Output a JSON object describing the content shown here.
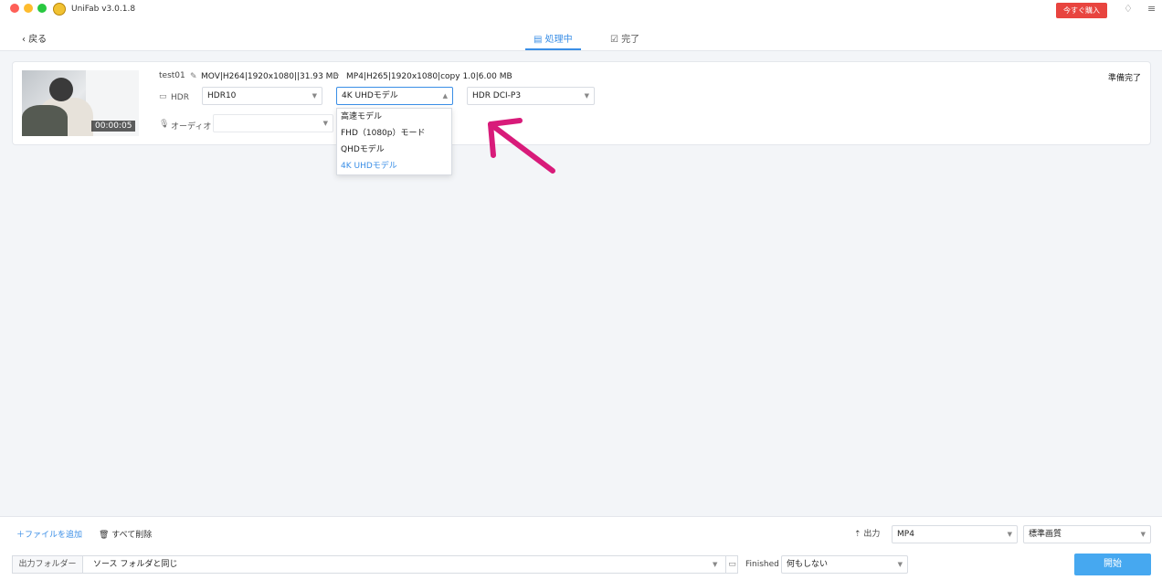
{
  "app": {
    "title": "UniFab v3.0.1.8",
    "buy_label": "今すぐ購入"
  },
  "nav": {
    "back_label": "戻る",
    "tabs": [
      {
        "label": "処理中",
        "active": true
      },
      {
        "label": "完了",
        "active": false
      }
    ]
  },
  "task": {
    "filename": "test01",
    "source_info": "MOV|H264|1920x1080||31.93 MB",
    "output_info": "MP4|H265|1920x1080|copy 1.0|6.00 MB",
    "duration": "00:00:05",
    "status": "準備完了",
    "hdr_label": "HDR",
    "hdr_select": "HDR10",
    "model_select": "4K UHDモデル",
    "color_select": "HDR DCI-P3",
    "audio_label": "オーディオ",
    "audio_select": ""
  },
  "model_dropdown": {
    "options": [
      "高速モデル",
      "FHD（1080p）モード",
      "QHDモデル",
      "4K UHDモデル"
    ],
    "selected_index": 3
  },
  "bottom": {
    "add_file": "ファイルを追加",
    "delete_all": "すべて削除",
    "output_label": "出力",
    "output_format": "MP4",
    "quality_select": "標準画質",
    "folder_label": "出力フォルダー",
    "folder_value": "ソース フォルダと同じ",
    "finished_label": "Finished",
    "finished_select": "何もしない",
    "start_label": "開始"
  },
  "colors": {
    "accent": "#3a8ee6",
    "start_button": "#46a8f0",
    "buy_button": "#e8443f",
    "annotation_arrow": "#d81b7a",
    "traffic_red": "#fe5f57",
    "traffic_yellow": "#febc2e",
    "traffic_green": "#28c840"
  },
  "icons": {
    "back": "chevron-left-icon",
    "processing_tab": "list-icon",
    "done_tab": "check-box-icon",
    "edit": "edit-icon",
    "hdr": "monitor-icon",
    "audio": "microphone-icon",
    "delete": "trash-icon",
    "output": "upload-icon",
    "folder": "folder-icon"
  }
}
